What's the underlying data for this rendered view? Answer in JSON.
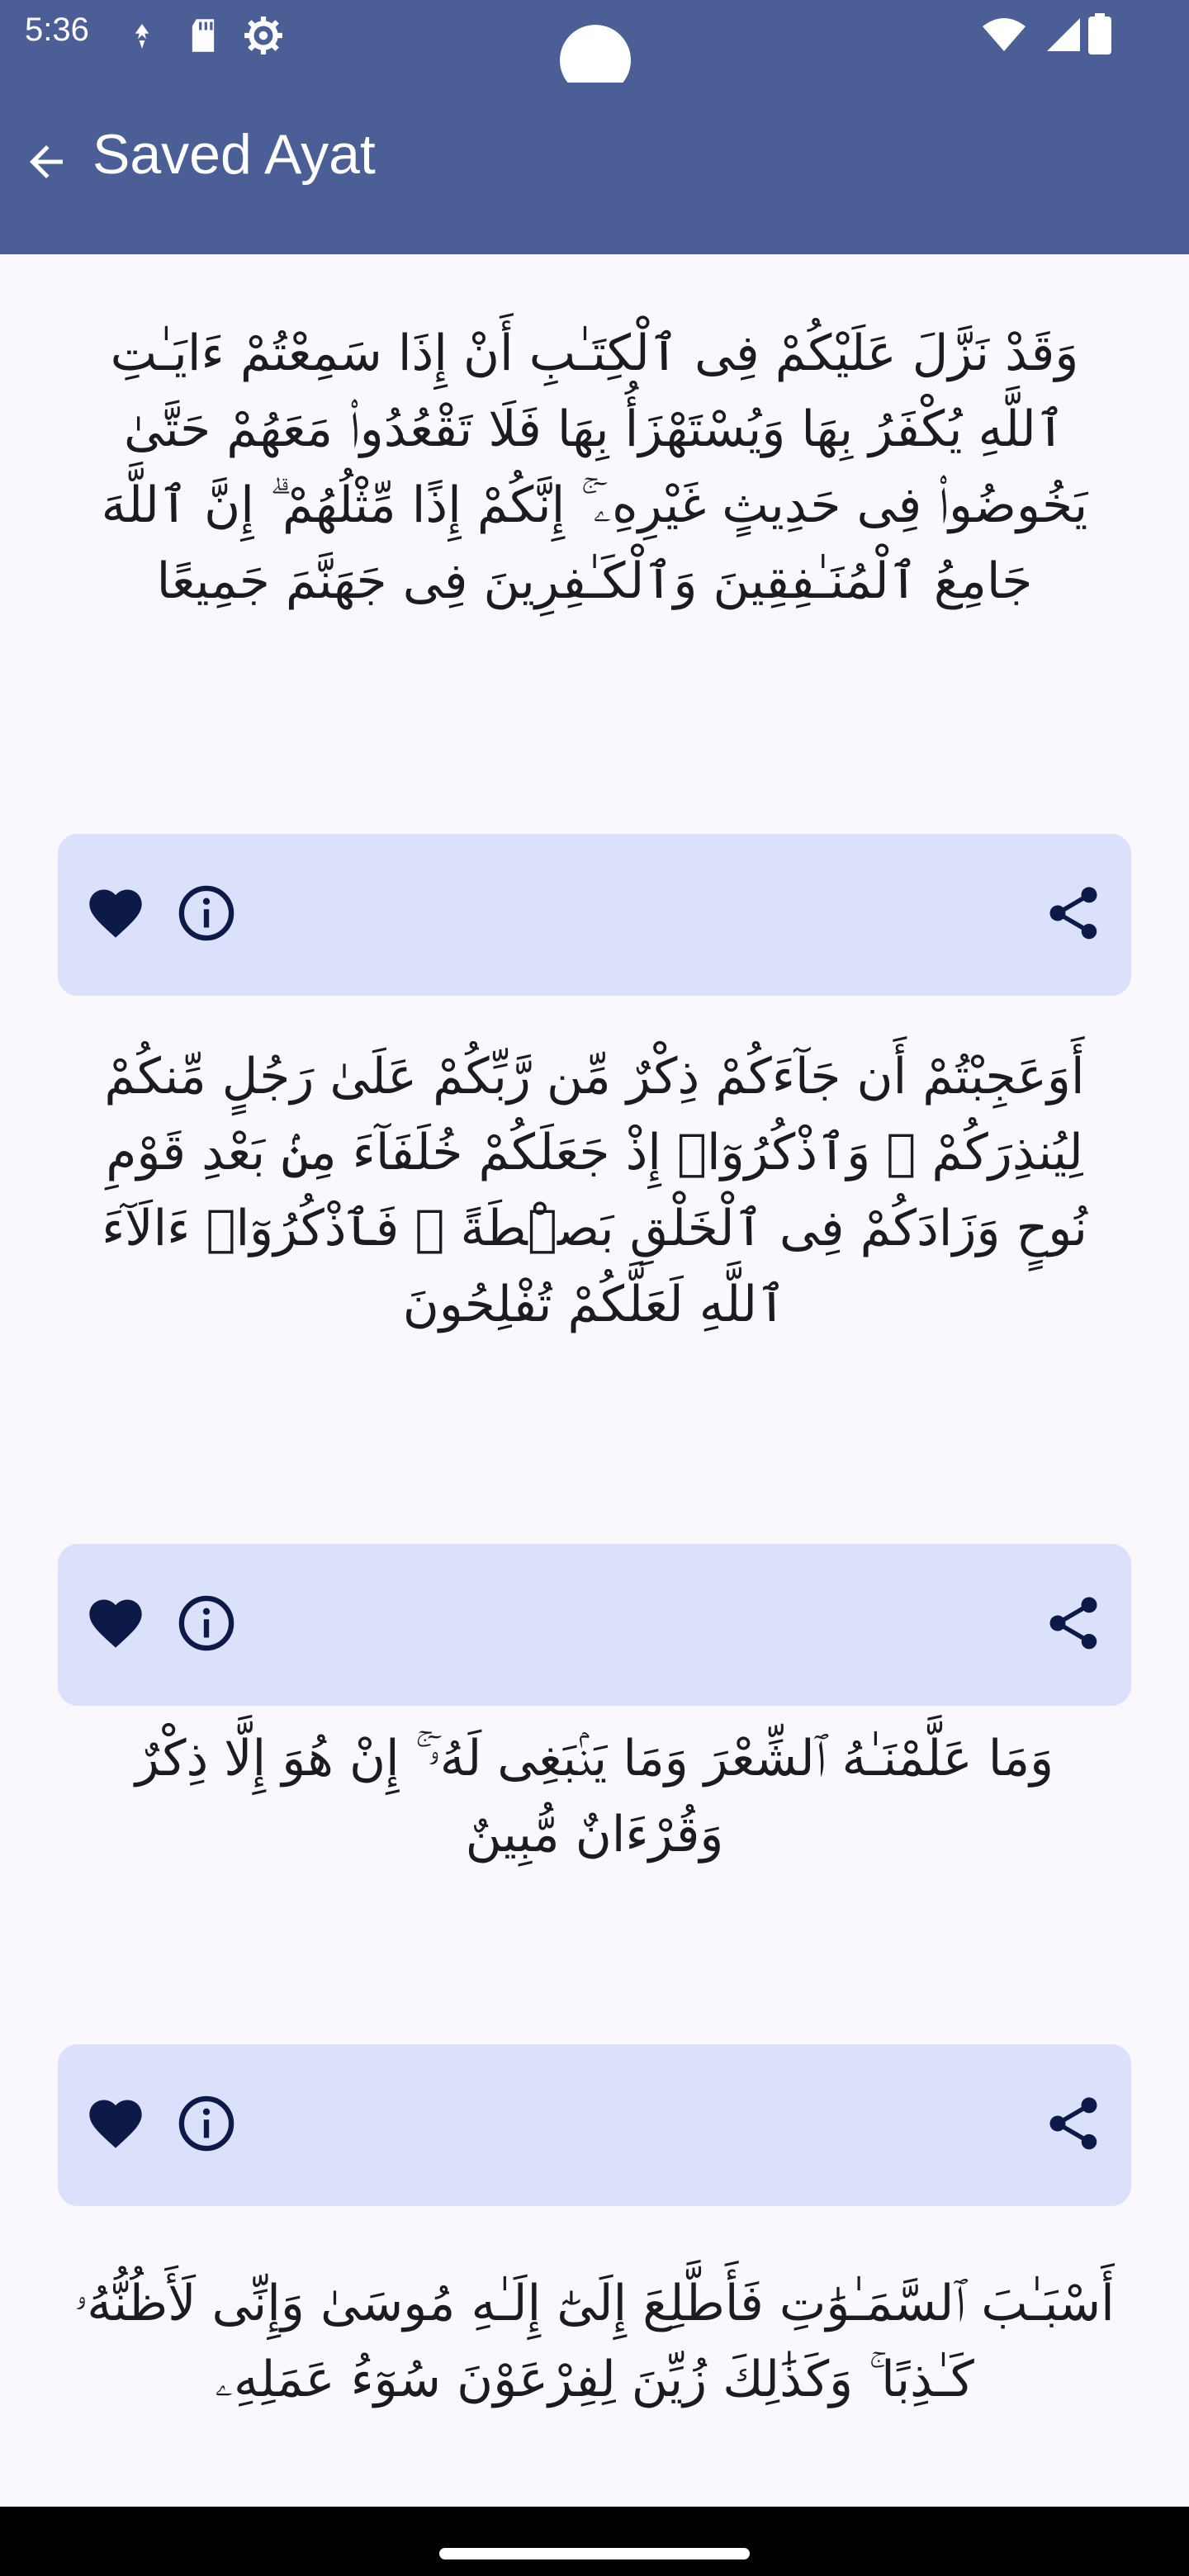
{
  "status_bar": {
    "time": "5:36"
  },
  "app_bar": {
    "title": "Saved Ayat"
  },
  "colors": {
    "primary": "#4c5e96",
    "card": "#dce1fb",
    "icon": "#0d1a48",
    "background": "#fbf8fd"
  },
  "ayat": [
    {
      "text": "وَقَدْ نَزَّلَ عَلَيْكُمْ فِى ٱلْكِتَـٰبِ أَنْ إِذَا سَمِعْتُمْ ءَايَـٰتِ ٱللَّهِ يُكْفَرُ بِهَا وَيُسْتَهْزَأُ بِهَا فَلَا تَقْعُدُوا۟ مَعَهُمْ حَتَّىٰ يَخُوضُوا۟ فِى حَدِيثٍ غَيْرِهِۦٓ ۚ إِنَّكُمْ إِذًا مِّثْلُهُمْ ۗ إِنَّ ٱللَّهَ جَامِعُ ٱلْمُنَـٰفِقِينَ وَٱلْكَـٰفِرِينَ فِى جَهَنَّمَ جَمِيعًا"
    },
    {
      "text": "أَوَعَجِبْتُمْ أَن جَآءَكُمْ ذِكْرٌ مِّن رَّبِّكُمْ عَلَىٰ رَجُلٍ مِّنكُمْ لِيُنذِرَكُمْ ۚ وَٱذْكُرُوٓا۟ إِذْ جَعَلَكُمْ خُلَفَآءَ مِنۢ بَعْدِ قَوْمِ نُوحٍ وَزَادَكُمْ فِى ٱلْخَلْقِ بَصْۜطَةً ۖ فَٱذْكُرُوٓا۟ ءَالَآءَ ٱللَّهِ لَعَلَّكُمْ تُفْلِحُونَ"
    },
    {
      "text": "وَمَا عَلَّمْنَـٰهُ ٱلشِّعْرَ وَمَا يَنۢبَغِى لَهُۥٓ ۚ إِنْ هُوَ إِلَّا ذِكْرٌ وَقُرْءَانٌ مُّبِينٌ"
    },
    {
      "text": "أَسْبَـٰبَ ٱلسَّمَـٰوَٰتِ فَأَطَّلِعَ إِلَىٰٓ إِلَـٰهِ مُوسَىٰ وَإِنِّى لَأَظُنُّهُۥ كَـٰذِبًا ۚ وَكَذَٰلِكَ زُيِّنَ لِفِرْعَوْنَ سُوٓءُ عَمَلِهِۦ"
    }
  ],
  "icons": {
    "back": "arrow-back-icon",
    "favorite": "heart-icon",
    "info": "info-icon",
    "share": "share-icon"
  }
}
